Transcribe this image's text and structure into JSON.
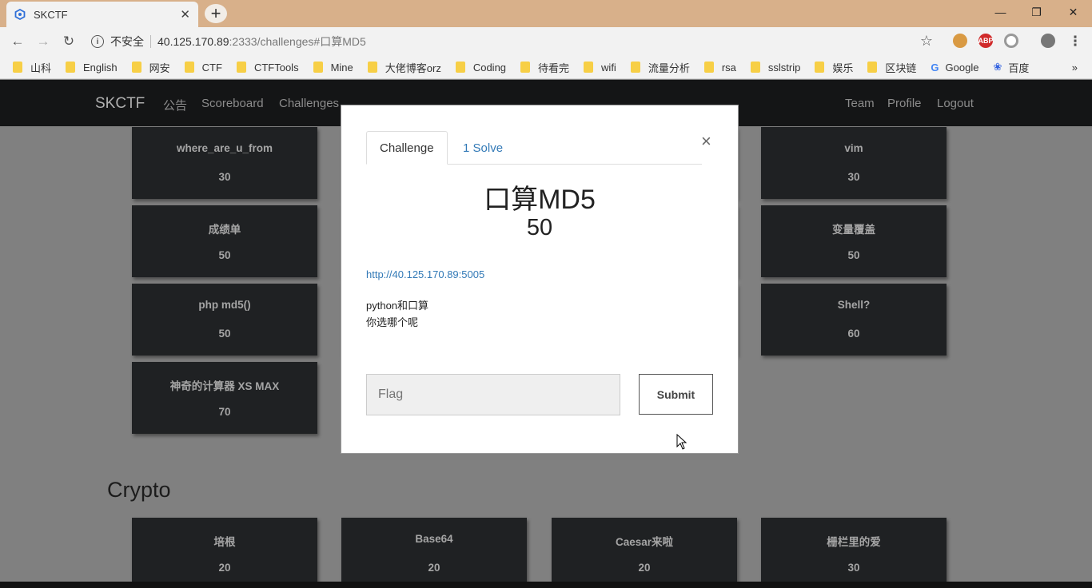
{
  "browser": {
    "tab_title": "SKCTF",
    "url_label": "不安全",
    "url_host": "40.125.170.89",
    "url_port": ":2333",
    "url_path": "/challenges#口算MD5",
    "ext_abp": "ABP",
    "bookmarks": [
      "山科",
      "English",
      "网安",
      "CTF",
      "CTFTools",
      "Mine",
      "大佬博客orz",
      "Coding",
      "待看完",
      "wifi",
      "流量分析",
      "rsa",
      "sslstrip",
      "娱乐",
      "区块链",
      "Google",
      "百度"
    ]
  },
  "nav": {
    "brand": "SKCTF",
    "links": [
      "公告",
      "Scoreboard",
      "Challenges"
    ],
    "right_links": [
      "Team",
      "Profile",
      "Logout"
    ]
  },
  "cards": [
    {
      "name": "where_are_u_from",
      "points": "30"
    },
    {
      "name": "成绩单",
      "points": "50"
    },
    {
      "name": "php md5()",
      "points": "50"
    },
    {
      "name": "神奇的计算器 XS MAX",
      "points": "70"
    },
    {
      "name": "vim",
      "points": "30"
    },
    {
      "name": "变量覆盖",
      "points": "50"
    },
    {
      "name": "Shell?",
      "points": "60"
    }
  ],
  "section_crypto": "Crypto",
  "crypto_cards": [
    {
      "name": "培根",
      "points": "20"
    },
    {
      "name": "Base64",
      "points": "20"
    },
    {
      "name": "Caesar来啦",
      "points": "20"
    },
    {
      "name": "栅栏里的爱",
      "points": "30"
    }
  ],
  "modal": {
    "tab_challenge": "Challenge",
    "tab_solves": "1 Solve",
    "title": "口算MD5",
    "value": "50",
    "link": "http://40.125.170.89:5005",
    "desc_line1": "python和口算",
    "desc_line2": "你选哪个呢",
    "flag_placeholder": "Flag",
    "submit_label": "Submit"
  }
}
